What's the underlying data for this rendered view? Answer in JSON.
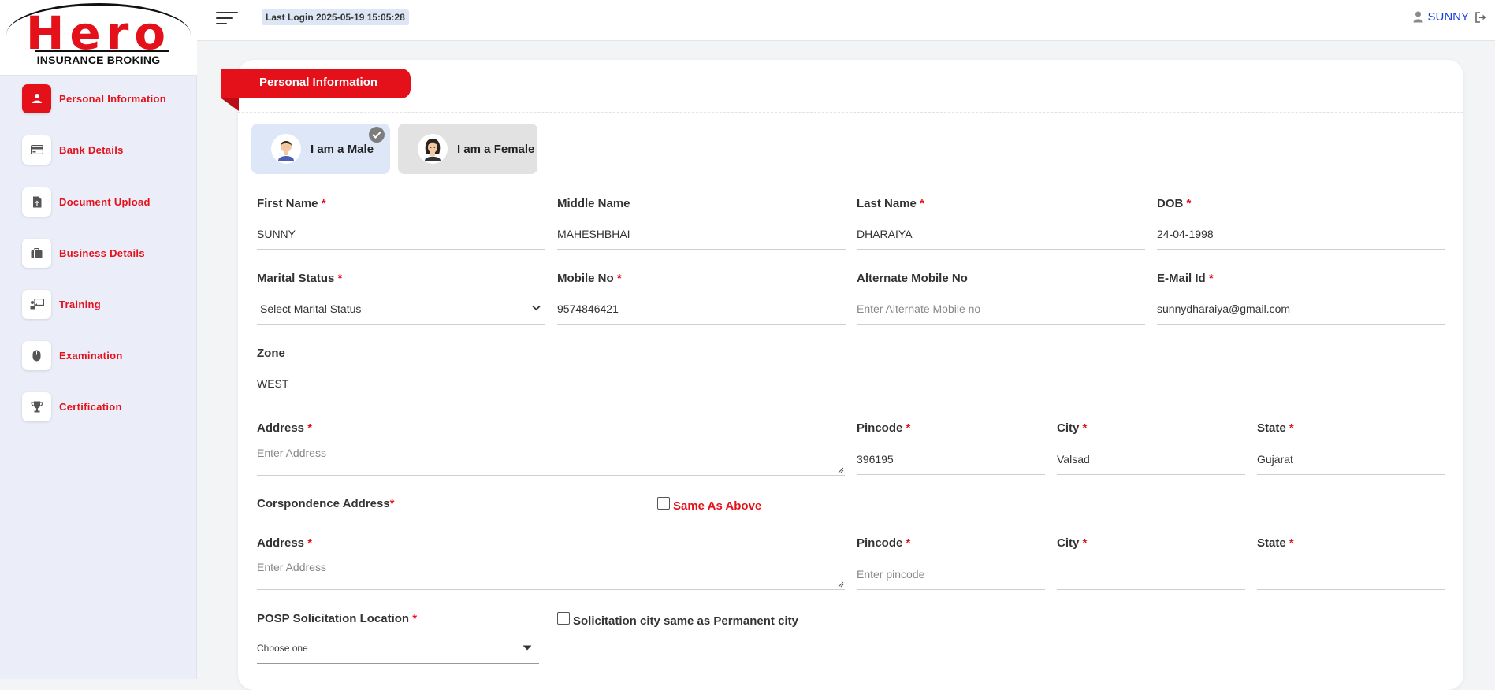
{
  "brand": {
    "logo_word": "Hero",
    "logo_sub": "INSURANCE BROKING",
    "accent": "#e4111b"
  },
  "sidebar": {
    "items": [
      {
        "label": "Personal Information",
        "icon": "user-icon",
        "active": true
      },
      {
        "label": "Bank Details",
        "icon": "card-icon"
      },
      {
        "label": "Document Upload",
        "icon": "document-icon"
      },
      {
        "label": "Business Details",
        "icon": "briefcase-icon"
      },
      {
        "label": "Training",
        "icon": "presentation-icon"
      },
      {
        "label": "Examination",
        "icon": "mouse-icon"
      },
      {
        "label": "Certification",
        "icon": "trophy-icon"
      }
    ]
  },
  "topbar": {
    "last_login": "Last Login 2025-05-19 15:05:28",
    "user_name": "SUNNY"
  },
  "form": {
    "section_title": "Personal Information",
    "gender": {
      "male_label": "I am a Male",
      "female_label": "I am a Female",
      "selected": "male"
    },
    "first_name": {
      "label": "First Name",
      "value": "SUNNY"
    },
    "middle_name": {
      "label": "Middle Name",
      "value": "MAHESHBHAI"
    },
    "last_name": {
      "label": "Last Name",
      "value": "DHARAIYA"
    },
    "dob": {
      "label": "DOB",
      "value": "24-04-1998"
    },
    "marital_status": {
      "label": "Marital Status",
      "value": "Select Marital Status"
    },
    "mobile": {
      "label": "Mobile No",
      "value": "9574846421"
    },
    "alt_mobile": {
      "label": "Alternate Mobile No",
      "placeholder": "Enter Alternate Mobile no"
    },
    "email": {
      "label": "E-Mail Id",
      "value": "sunnydharaiya@gmail.com"
    },
    "zone": {
      "label": "Zone",
      "value": "WEST"
    },
    "address": {
      "label": "Address",
      "placeholder": "Enter Address"
    },
    "pincode": {
      "label": "Pincode",
      "value": "396195"
    },
    "city": {
      "label": "City",
      "value": "Valsad"
    },
    "state": {
      "label": "State",
      "value": "Gujarat"
    },
    "corr_heading": "Corspondence Address",
    "same_as_above": "Same As Above",
    "corr_address": {
      "label": "Address",
      "placeholder": "Enter Address"
    },
    "corr_pincode": {
      "label": "Pincode",
      "placeholder": "Enter pincode"
    },
    "corr_city": {
      "label": "City",
      "value": ""
    },
    "corr_state": {
      "label": "State",
      "value": ""
    },
    "posp_location": {
      "label": "POSP Solicitation Location",
      "value": "Choose one"
    },
    "solicitation_same": "Solicitation city same as Permanent city"
  }
}
